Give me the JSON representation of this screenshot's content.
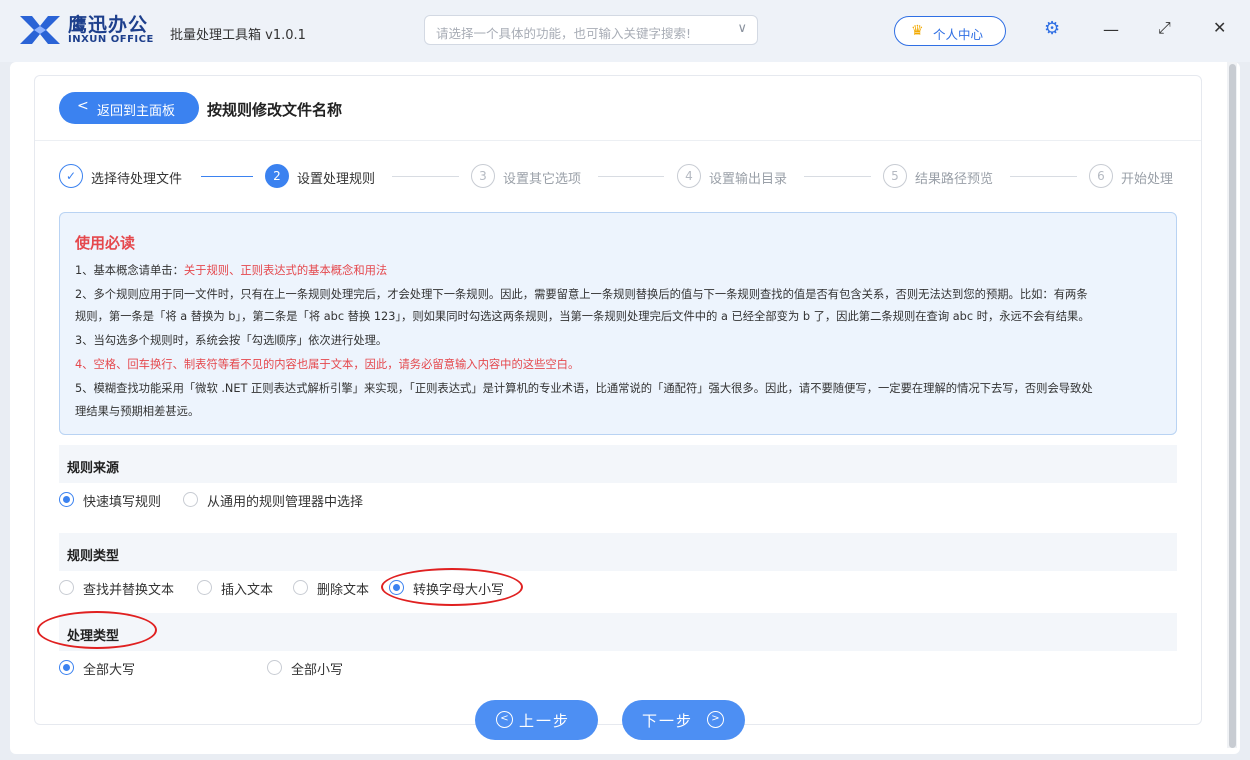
{
  "header": {
    "brand_cn": "鹰迅办公",
    "brand_en": "INXUN OFFICE",
    "app_title": "批量处理工具箱 v1.0.1",
    "search_placeholder": "请选择一个具体的功能，也可输入关键字搜索!",
    "user_center": "个人中心"
  },
  "page": {
    "back_label": "返回到主面板",
    "title": "按规则修改文件名称"
  },
  "steps": [
    {
      "num": "✓",
      "label": "选择待处理文件",
      "state": "done"
    },
    {
      "num": "2",
      "label": "设置处理规则",
      "state": "active"
    },
    {
      "num": "3",
      "label": "设置其它选项",
      "state": "pending"
    },
    {
      "num": "4",
      "label": "设置输出目录",
      "state": "pending"
    },
    {
      "num": "5",
      "label": "结果路径预览",
      "state": "pending"
    },
    {
      "num": "6",
      "label": "开始处理",
      "state": "pending"
    }
  ],
  "notice": {
    "title": "使用必读",
    "line1_prefix": "1、基本概念请单击：",
    "line1_link": "关于规则、正则表达式的基本概念和用法",
    "line2a": "2、多个规则应用于同一文件时，只有在上一条规则处理完后，才会处理下一条规则。因此，需要留意上一条规则替换后的值与下一条规则查找的值是否有包含关系，否则无法达到您的预期。比如：有两条",
    "line2b": "规则，第一条是「将 a 替换为 b」，第二条是「将 abc 替换 123」，则如果同时勾选这两条规则，当第一条规则处理完后文件中的 a 已经全部变为 b 了，因此第二条规则在查询 abc 时，永远不会有结果。",
    "line3": "3、当勾选多个规则时，系统会按「勾选顺序」依次进行处理。",
    "line4": "4、空格、回车换行、制表符等看不见的内容也属于文本，因此，请务必留意输入内容中的这些空白。",
    "line5a": "5、模糊查找功能采用「微软 .NET 正则表达式解析引擎」来实现，「正则表达式」是计算机的专业术语，比通常说的「通配符」强大很多。因此，请不要随便写，一定要在理解的情况下去写，否则会导致处",
    "line5b": "理结果与预期相差甚远。"
  },
  "rule_source": {
    "title": "规则来源",
    "options": [
      "快速填写规则",
      "从通用的规则管理器中选择"
    ],
    "selected": 0
  },
  "rule_type": {
    "title": "规则类型",
    "options": [
      "查找并替换文本",
      "插入文本",
      "删除文本",
      "转换字母大小写"
    ],
    "selected": 3
  },
  "process_type": {
    "title": "处理类型",
    "options": [
      "全部大写",
      "全部小写"
    ],
    "selected": 0
  },
  "nav": {
    "prev": "上一步",
    "next": "下一步"
  },
  "colors": {
    "accent": "#3b82f0",
    "warning_red": "#e5484d",
    "highlight_oval": "#e02020"
  }
}
